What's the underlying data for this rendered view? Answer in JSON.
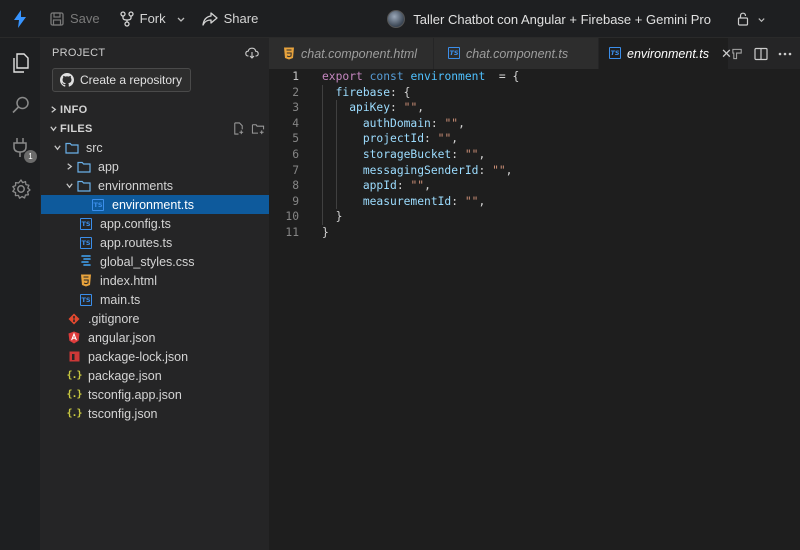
{
  "topbar": {
    "save_label": "Save",
    "fork_label": "Fork",
    "share_label": "Share",
    "project_title": "Taller Chatbot con Angular + Firebase + Gemini Pro"
  },
  "activitybar": {
    "extensions_badge": "1"
  },
  "sidebar": {
    "header": "PROJECT",
    "create_repo_label": "Create a repository",
    "sections": {
      "info": "INFO",
      "files": "FILES"
    },
    "tree": [
      {
        "label": "src",
        "type": "folder",
        "expanded": true,
        "depth": 1
      },
      {
        "label": "app",
        "type": "folder",
        "expanded": false,
        "depth": 2
      },
      {
        "label": "environments",
        "type": "folder",
        "expanded": true,
        "depth": 2
      },
      {
        "label": "environment.ts",
        "type": "ts",
        "depth": 3,
        "selected": true
      },
      {
        "label": "app.config.ts",
        "type": "ts",
        "depth": 2
      },
      {
        "label": "app.routes.ts",
        "type": "ts",
        "depth": 2
      },
      {
        "label": "global_styles.css",
        "type": "css",
        "depth": 2
      },
      {
        "label": "index.html",
        "type": "html",
        "depth": 2
      },
      {
        "label": "main.ts",
        "type": "ts",
        "depth": 2
      },
      {
        "label": ".gitignore",
        "type": "git",
        "depth": 1
      },
      {
        "label": "angular.json",
        "type": "angular",
        "depth": 1
      },
      {
        "label": "package-lock.json",
        "type": "npm",
        "depth": 1
      },
      {
        "label": "package.json",
        "type": "json",
        "depth": 1
      },
      {
        "label": "tsconfig.app.json",
        "type": "json",
        "depth": 1
      },
      {
        "label": "tsconfig.json",
        "type": "json",
        "depth": 1
      }
    ]
  },
  "tabs": [
    {
      "label": "chat.component.html",
      "type": "html",
      "active": false
    },
    {
      "label": "chat.component.ts",
      "type": "ts",
      "active": false
    },
    {
      "label": "environment.ts",
      "type": "ts",
      "active": true
    }
  ],
  "editor": {
    "line_numbers": [
      "1",
      "2",
      "3",
      "4",
      "5",
      "6",
      "7",
      "8",
      "9",
      "10",
      "11"
    ],
    "tokens": {
      "export": "export",
      "const": "const",
      "environment": "environment",
      "eq_brace": "= {",
      "firebase": "firebase",
      "apiKey": "apiKey",
      "authDomain": "authDomain",
      "projectId": "projectId",
      "storageBucket": "storageBucket",
      "messagingSenderId": "messagingSenderId",
      "appId": "appId",
      "measurementId": "measurementId",
      "empty_string": "\"\"",
      "colon": ":",
      "comma": ",",
      "open_brace": "{",
      "close_brace": "}"
    }
  },
  "colors": {
    "accent": "#3794ff",
    "selection": "#0e5a9c",
    "keyword": "#c586c0",
    "property": "#9cdcfe",
    "string": "#ce9178"
  }
}
